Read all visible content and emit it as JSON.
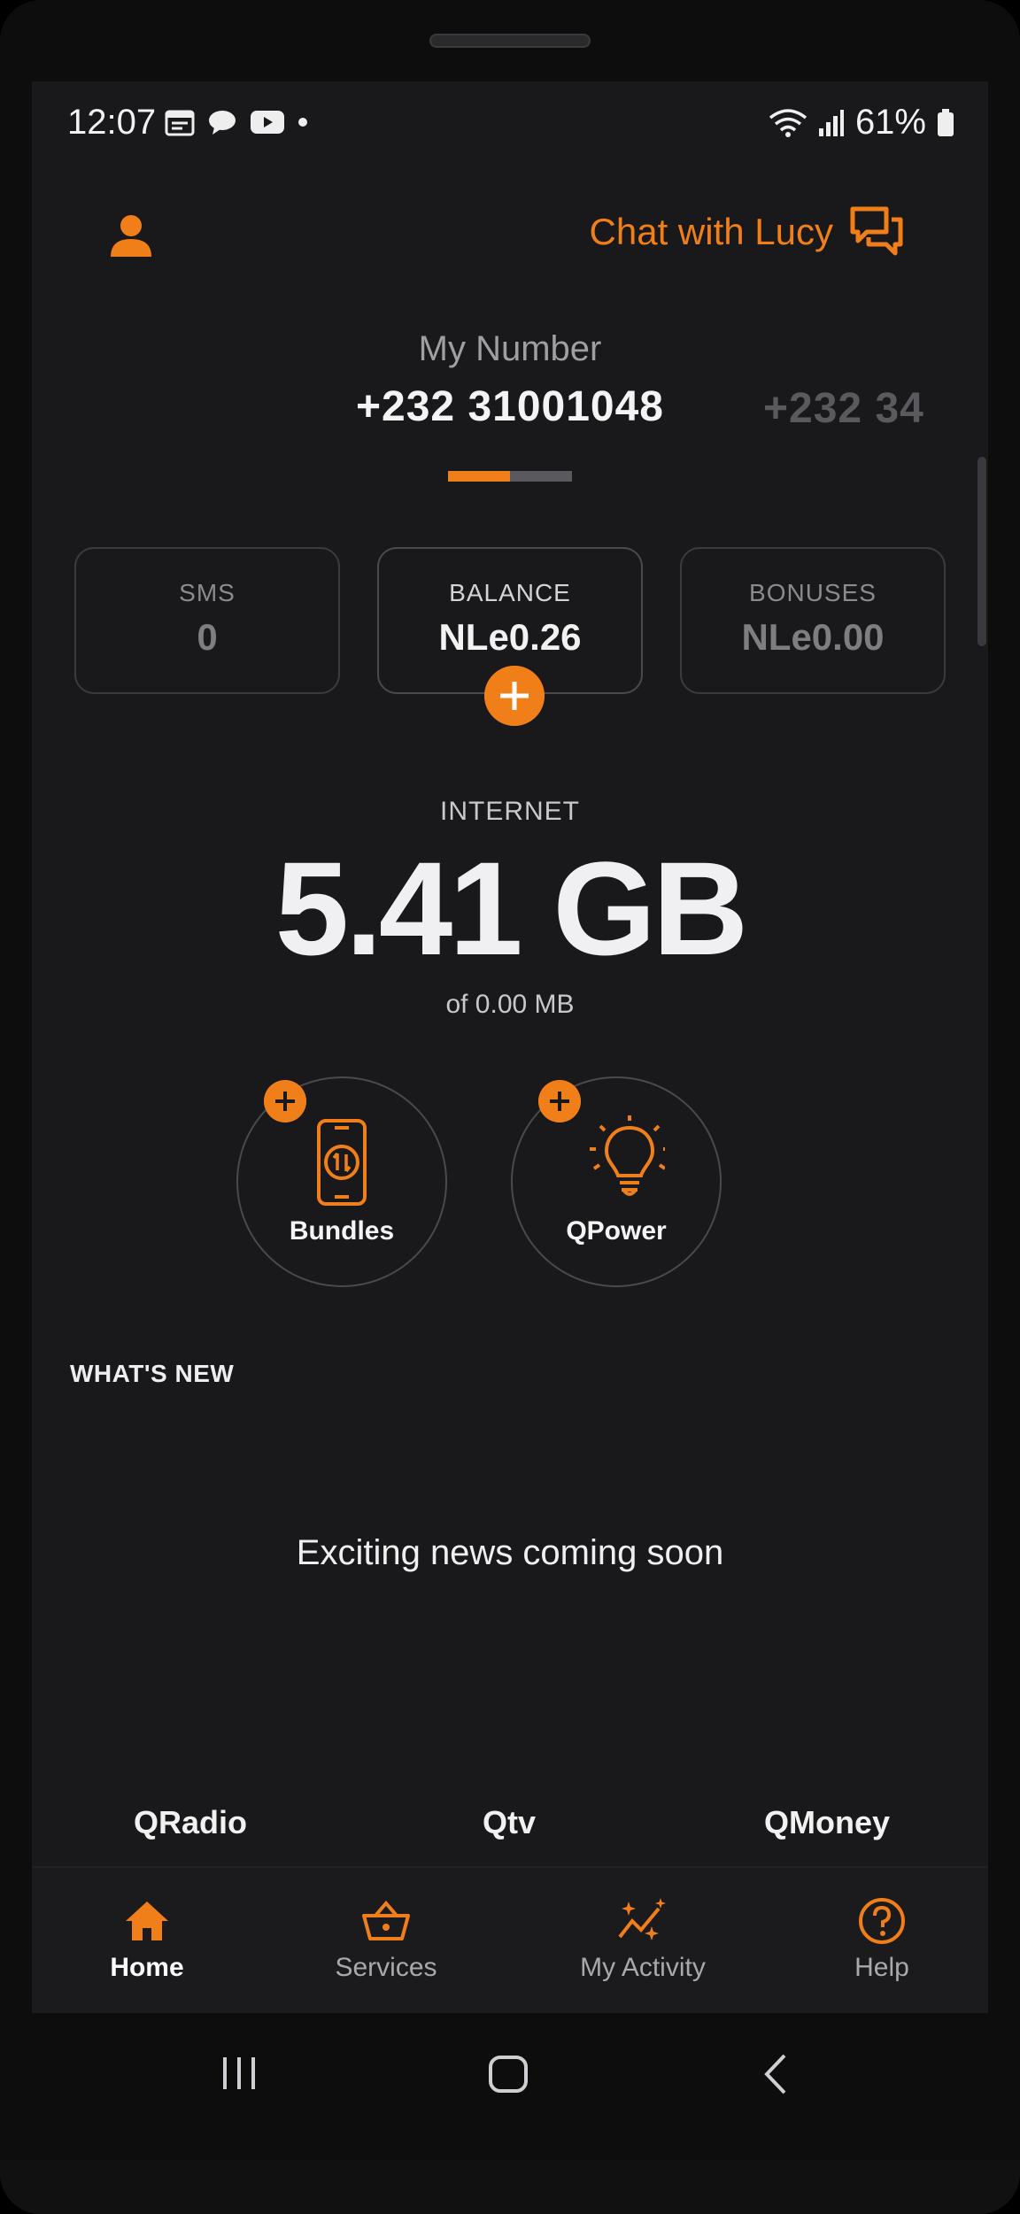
{
  "status_bar": {
    "time": "12:07",
    "battery": "61%"
  },
  "header": {
    "chat_label": "Chat with Lucy"
  },
  "number_carousel": {
    "label": "My Number",
    "current_number": "+232 31001048",
    "next_number": "+232 34"
  },
  "cards": [
    {
      "label": "SMS",
      "value": "0"
    },
    {
      "label": "BALANCE",
      "value": "NLe0.26"
    },
    {
      "label": "BONUSES",
      "value": "NLe0.00"
    }
  ],
  "internet": {
    "label": "INTERNET",
    "value": "5.41 GB",
    "of_text": "of 0.00 MB"
  },
  "actions": [
    {
      "label": "Bundles",
      "icon": "phone-data-icon"
    },
    {
      "label": "QPower",
      "icon": "lightbulb-icon"
    }
  ],
  "whats_new": {
    "heading": "WHAT'S NEW",
    "empty_text": "Exciting news coming soon"
  },
  "quick_links": [
    "QRadio",
    "Qtv",
    "QMoney"
  ],
  "bottom_nav": [
    {
      "label": "Home",
      "icon": "home-icon",
      "active": true
    },
    {
      "label": "Services",
      "icon": "basket-icon",
      "active": false
    },
    {
      "label": "My Activity",
      "icon": "sparkles-icon",
      "active": false
    },
    {
      "label": "Help",
      "icon": "help-icon",
      "active": false
    }
  ],
  "colors": {
    "accent": "#f07f1a",
    "background": "#19181b",
    "text": "#f1f1f1",
    "muted": "#8a8a8f"
  }
}
